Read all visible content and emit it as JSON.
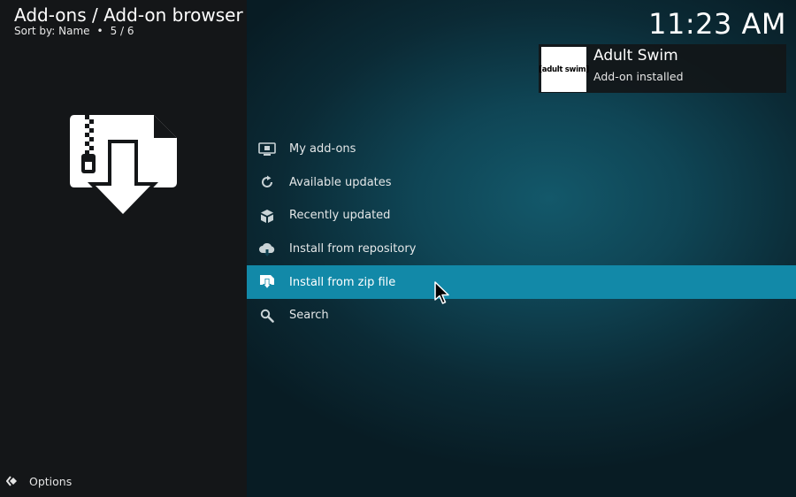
{
  "header": {
    "title": "Add-ons / Add-on browser",
    "sort_label": "Sort by: Name",
    "separator": "•",
    "position": "5 / 6"
  },
  "clock": "11:23 AM",
  "notification": {
    "thumb_text": "[adult swim]",
    "title": "Adult Swim",
    "message": "Add-on installed"
  },
  "menu": {
    "items": [
      {
        "label": "My add-ons",
        "icon": "monitor-icon"
      },
      {
        "label": "Available updates",
        "icon": "refresh-icon"
      },
      {
        "label": "Recently updated",
        "icon": "box-icon"
      },
      {
        "label": "Install from repository",
        "icon": "cloud-download-icon"
      },
      {
        "label": "Install from zip file",
        "icon": "zip-download-icon",
        "selected": true
      },
      {
        "label": "Search",
        "icon": "search-icon"
      }
    ]
  },
  "footer": {
    "options_label": "Options"
  },
  "colors": {
    "selected": "#1289a8",
    "left_panel": "#141618"
  }
}
